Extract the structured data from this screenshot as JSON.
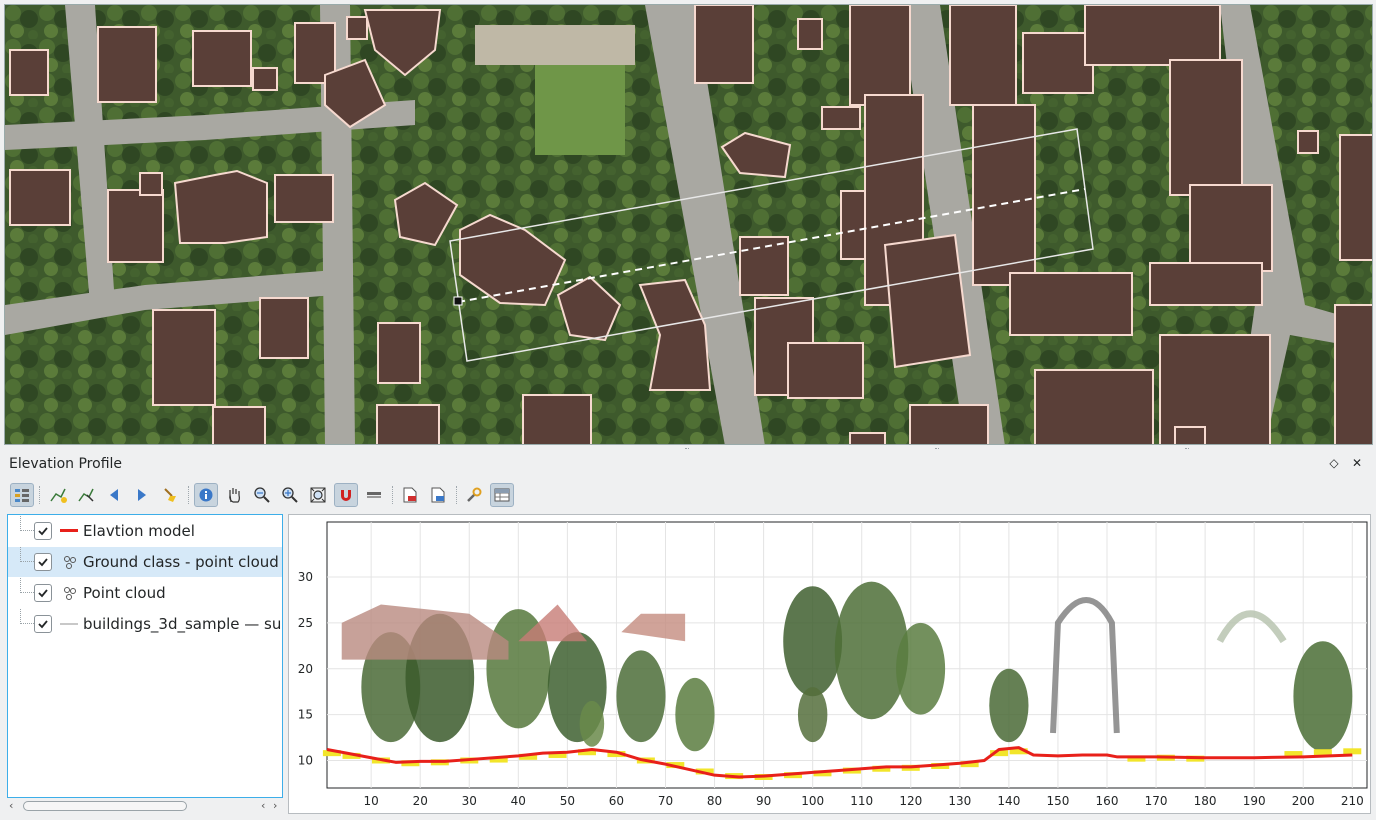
{
  "dock": {
    "title": "Elevation Profile",
    "float_icon": "diamond-icon",
    "close_icon": "close-icon"
  },
  "toolbar": {
    "buttons": [
      {
        "icon": "layer-tree-icon",
        "active": true
      },
      {
        "icon": "capture-curve-icon",
        "active": false
      },
      {
        "icon": "capture-from-feature-icon",
        "active": false
      },
      {
        "icon": "nudge-left-icon",
        "active": false
      },
      {
        "icon": "nudge-right-icon",
        "active": false
      },
      {
        "icon": "clear-icon",
        "active": false
      },
      {
        "icon": "identify-icon",
        "active": true
      },
      {
        "icon": "pan-icon",
        "active": false
      },
      {
        "icon": "zoom-x-icon",
        "active": false
      },
      {
        "icon": "zoom-icon",
        "active": false
      },
      {
        "icon": "zoom-full-icon",
        "active": false
      },
      {
        "icon": "snapping-icon",
        "active": true
      },
      {
        "icon": "measure-icon",
        "active": false
      },
      {
        "icon": "export-pdf-icon",
        "active": false
      },
      {
        "icon": "export-image-icon",
        "active": false
      },
      {
        "icon": "settings-wrench-icon",
        "active": false
      },
      {
        "icon": "table-icon",
        "active": true
      }
    ]
  },
  "layers": [
    {
      "label": "Elavtion model",
      "checked": true,
      "symbol": "red-line",
      "color": "#e8201a",
      "selected": false
    },
    {
      "label": "Ground class - point cloud",
      "checked": true,
      "symbol": "point-cloud-icon",
      "selected": true
    },
    {
      "label": "Point cloud",
      "checked": true,
      "symbol": "point-cloud-icon",
      "selected": false
    },
    {
      "label": "buildings_3d_sample — su",
      "checked": true,
      "symbol": "grey-line",
      "color": "#c8c8c8",
      "selected": false
    }
  ],
  "chart_data": {
    "type": "scatter",
    "title": "",
    "xlabel": "",
    "ylabel": "",
    "xlim": [
      1,
      213
    ],
    "ylim": [
      7,
      36
    ],
    "x_ticks": [
      10,
      20,
      30,
      40,
      50,
      60,
      70,
      80,
      90,
      100,
      110,
      120,
      130,
      140,
      150,
      160,
      170,
      180,
      190,
      200,
      210
    ],
    "y_ticks": [
      10,
      15,
      20,
      25,
      30
    ],
    "grid": true,
    "series": [
      {
        "kind": "line",
        "color": "#e8201a",
        "x": [
          1,
          5,
          10,
          15,
          20,
          25,
          30,
          35,
          40,
          45,
          50,
          55,
          60,
          65,
          70,
          75,
          80,
          85,
          90,
          95,
          100,
          105,
          110,
          115,
          120,
          125,
          130,
          135,
          138,
          142,
          145,
          150,
          155,
          160,
          162,
          170,
          180,
          190,
          200,
          210
        ],
        "y": [
          11.2,
          10.8,
          10.3,
          9.8,
          9.9,
          9.9,
          10.1,
          10.3,
          10.5,
          10.8,
          10.9,
          11.2,
          10.9,
          10.1,
          9.6,
          9.0,
          8.4,
          8.2,
          8.3,
          8.5,
          8.7,
          8.9,
          9.1,
          9.3,
          9.3,
          9.5,
          9.7,
          10.0,
          11.2,
          11.4,
          10.6,
          10.5,
          10.6,
          10.6,
          10.4,
          10.4,
          10.3,
          10.3,
          10.4,
          10.6
        ]
      },
      {
        "kind": "points",
        "color": "#f2e52a",
        "x": [
          2,
          6,
          12,
          18,
          24,
          30,
          36,
          42,
          48,
          54,
          60,
          66,
          72,
          78,
          84,
          90,
          96,
          102,
          108,
          114,
          120,
          126,
          132,
          138,
          142,
          166,
          172,
          178,
          198,
          204,
          210
        ],
        "y": [
          10.8,
          10.5,
          10.0,
          9.7,
          9.8,
          10.0,
          10.1,
          10.4,
          10.6,
          10.9,
          10.7,
          10.0,
          9.5,
          8.8,
          8.3,
          8.2,
          8.4,
          8.6,
          8.9,
          9.1,
          9.2,
          9.4,
          9.6,
          10.8,
          11.0,
          10.2,
          10.3,
          10.2,
          10.7,
          10.9,
          11.0
        ]
      }
    ]
  }
}
